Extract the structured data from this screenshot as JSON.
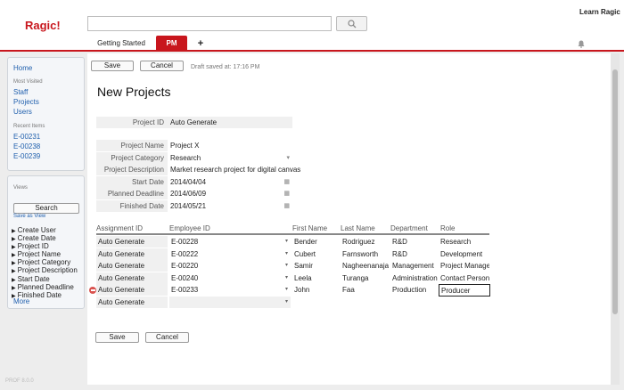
{
  "header": {
    "logo": "Ragic!",
    "search_placeholder": "",
    "learn_link": "Learn Ragic",
    "tabs": [
      {
        "label": "Getting Started"
      },
      {
        "label": "PM"
      },
      {
        "label": "+"
      }
    ],
    "accent_color": "#c8161d"
  },
  "sidebar": {
    "home": "Home",
    "most_visited_label": "Most Visited",
    "most_visited": [
      "Staff",
      "Projects",
      "Users"
    ],
    "recent_label": "Recent Items",
    "recent": [
      "E-00231",
      "E-00238",
      "E-00239"
    ],
    "views_label": "Views",
    "search_button": "Search",
    "save_as_view": "Save as View",
    "view_fields": [
      "Create User",
      "Create Date",
      "Project ID",
      "Project Name",
      "Project Category",
      "Project Description",
      "Start Date",
      "Planned Deadline",
      "Finished Date"
    ],
    "more": "More",
    "version": "PROF 8.0.0"
  },
  "toolbar": {
    "save_label": "Save",
    "cancel_label": "Cancel",
    "draft_text": "Draft saved at: 17:16 PM"
  },
  "form": {
    "title": "New Projects",
    "fields": [
      {
        "label": "Project ID",
        "value": "Auto Generate"
      },
      {
        "label": "Project Name",
        "value": "Project X"
      },
      {
        "label": "Project Category",
        "value": "Research"
      },
      {
        "label": "Project Description",
        "value": "Market research project for digital canvas"
      },
      {
        "label": "Start Date",
        "value": "2014/04/04"
      },
      {
        "label": "Planned Deadline",
        "value": "2014/06/09"
      },
      {
        "label": "Finished Date",
        "value": "2014/05/21"
      }
    ]
  },
  "subtable": {
    "columns": [
      "Assignment ID",
      "Employee ID",
      "First Name",
      "Last Name",
      "Department",
      "Role"
    ],
    "rows": [
      [
        "Auto Generate",
        "E-00228",
        "Bender",
        "Rodriguez",
        "R&D",
        "Research"
      ],
      [
        "Auto Generate",
        "E-00222",
        "Cubert",
        "Farnsworth",
        "R&D",
        "Development"
      ],
      [
        "Auto Generate",
        "E-00220",
        "Samir",
        "Nagheenanajar",
        "Management",
        "Project Manager"
      ],
      [
        "Auto Generate",
        "E-00240",
        "Leela",
        "Turanga",
        "Administration",
        "Contact Person"
      ],
      [
        "Auto Generate",
        "E-00233",
        "John",
        "Faa",
        "Production",
        "Producer"
      ],
      [
        "Auto Generate",
        "",
        "",
        "",
        "",
        ""
      ]
    ]
  },
  "footer": {
    "save_label": "Save",
    "cancel_label": "Cancel"
  }
}
